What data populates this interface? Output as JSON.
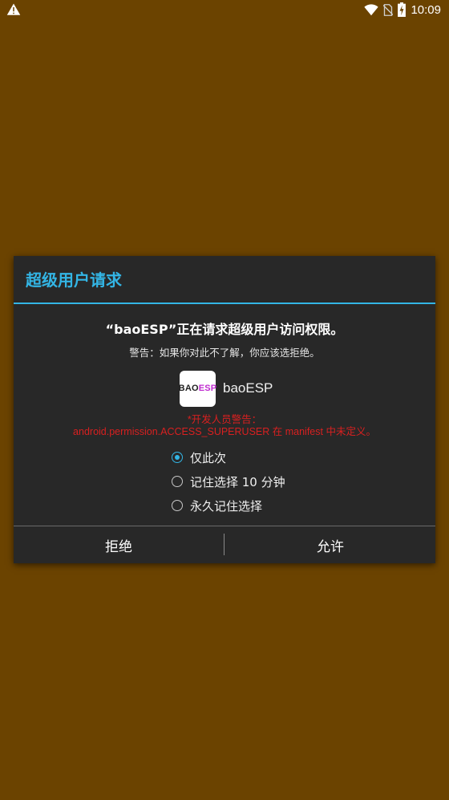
{
  "status_bar": {
    "time": "10:09",
    "icons": [
      "warning-icon",
      "wifi-icon",
      "no-sim-icon",
      "battery-charging-icon"
    ]
  },
  "dialog": {
    "title": "超级用户请求",
    "headline": "“baoESP”正在请求超级用户访问权限。",
    "warning": "警告：如果你对此不了解，你应该选拒绝。",
    "app": {
      "icon_text_dark": "BAO",
      "icon_text_accent": "ESP",
      "name": "baoESP"
    },
    "dev_warning_line1": "*开发人员警告：",
    "dev_warning_line2": "android.permission.ACCESS_SUPERUSER 在 manifest 中未定义。",
    "options": [
      {
        "label": "仅此次",
        "selected": true
      },
      {
        "label": "记住选择 10 分钟",
        "selected": false
      },
      {
        "label": "永久记住选择",
        "selected": false
      }
    ],
    "buttons": {
      "deny": "拒绝",
      "allow": "允许"
    }
  },
  "colors": {
    "background": "#6b4300",
    "dialog": "#282828",
    "accent": "#33b5e5",
    "dev_warning": "#d82020"
  }
}
